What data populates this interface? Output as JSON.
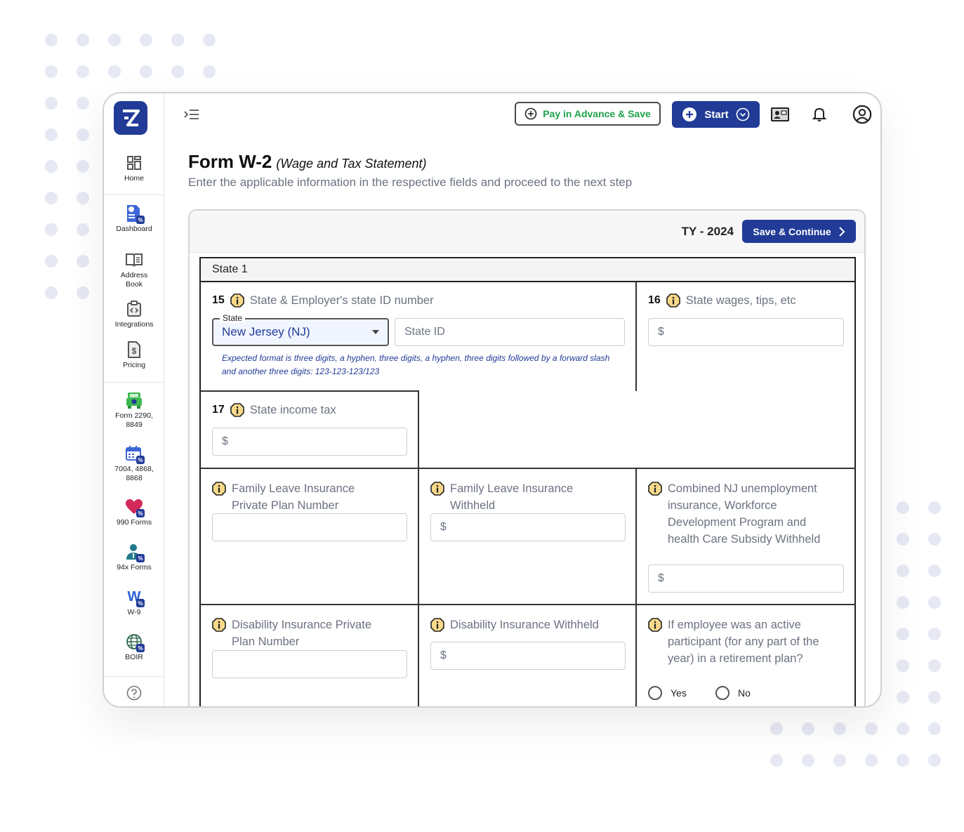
{
  "app": {
    "brand_color": "#213b97",
    "accent_green": "#1fa24a",
    "hint_color": "#213b97"
  },
  "sidebar": {
    "items": [
      {
        "label": "Home",
        "icon": "home-grid-icon"
      },
      {
        "label": "Dashboard",
        "icon": "dashboard-icon"
      },
      {
        "label": "Address Book",
        "icon": "address-book-icon"
      },
      {
        "label": "Integrations",
        "icon": "integrations-icon"
      },
      {
        "label": "Pricing",
        "icon": "pricing-icon"
      },
      {
        "label": "Form 2290, 8849",
        "icon": "truck-icon"
      },
      {
        "label": "7004, 4868, 8868",
        "icon": "calendar-icon"
      },
      {
        "label": "990 Forms",
        "icon": "heart-icon"
      },
      {
        "label": "94x Forms",
        "icon": "person-icon"
      },
      {
        "label": "W-9",
        "icon": "w9-icon"
      },
      {
        "label": "BOIR",
        "icon": "globe-icon"
      },
      {
        "label": "",
        "icon": "help-icon"
      }
    ]
  },
  "topbar": {
    "pay_label": "Pay in Advance & Save",
    "start_label": "Start"
  },
  "page": {
    "title": "Form W-2",
    "subtitle": "(Wage and Tax Statement)",
    "description": "Enter the applicable information in the respective fields and proceed to the next step"
  },
  "card": {
    "tax_year": "TY - 2024",
    "save_label": "Save & Continue"
  },
  "form": {
    "section_title": "State 1",
    "box15": {
      "number": "15",
      "label": "State & Employer's state ID number",
      "state_legend": "State",
      "state_value": "New Jersey (NJ)",
      "state_id_placeholder": "State ID",
      "hint": "Expected format is three digits, a hyphen, three digits, a hyphen, three digits followed by a forward slash and another three digits: 123-123-123/123"
    },
    "box16": {
      "number": "16",
      "label": "State wages, tips, etc",
      "prefix": "$"
    },
    "box17": {
      "number": "17",
      "label": "State income tax",
      "prefix": "$"
    },
    "fli_plan": {
      "label": "Family Leave Insurance Private Plan Number",
      "value": ""
    },
    "fli_withheld": {
      "label": "Family Leave Insurance Withheld",
      "prefix": "$"
    },
    "combined_nj": {
      "label": "Combined NJ unemployment insurance, Workforce Development Program and health Care Subsidy Withheld",
      "prefix": "$"
    },
    "di_plan": {
      "label": "Disability Insurance Private Plan Number",
      "value": ""
    },
    "di_withheld": {
      "label": "Disability Insurance Withheld",
      "prefix": "$"
    },
    "retirement": {
      "label": "If employee was an active participant (for any part of the year) in a retirement plan?",
      "options": [
        "Yes",
        "No"
      ],
      "selected": null
    }
  }
}
